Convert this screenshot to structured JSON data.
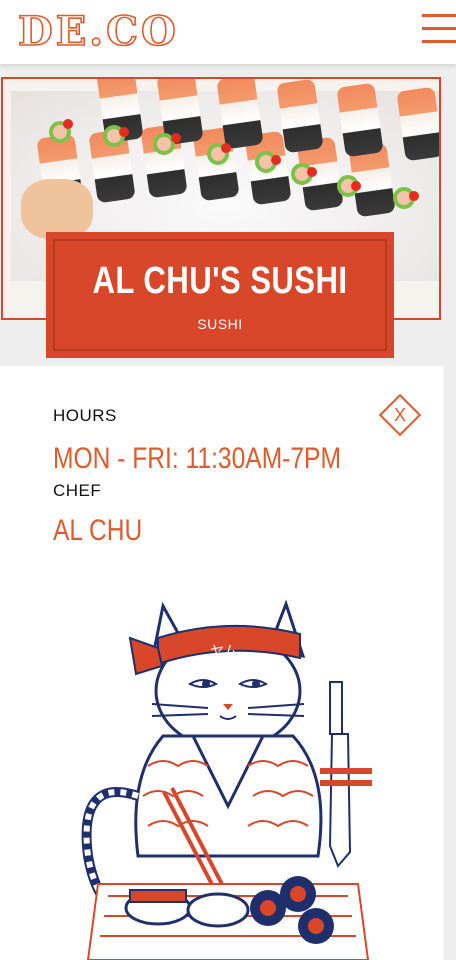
{
  "header": {
    "logo": "DE.CO",
    "menu_icon": "hamburger-menu-icon"
  },
  "hero": {
    "image_alt": "sushi-rolls-photo"
  },
  "restaurant": {
    "name": "AL CHU'S SUSHI",
    "category": "SUSHI"
  },
  "details": {
    "hours_label": "HOURS",
    "hours_value": "MON - FRI: 11:30AM-7PM",
    "chef_label": "CHEF",
    "chef_value": "AL CHU",
    "close_icon": "close-icon",
    "close_symbol": "X"
  },
  "illustration": {
    "headband_text": "ヤム",
    "image": "sushi-chef-cat-illustration"
  },
  "colors": {
    "accent": "#e05a2c",
    "brand_red": "#d9472a",
    "navy": "#1f2f6b"
  }
}
